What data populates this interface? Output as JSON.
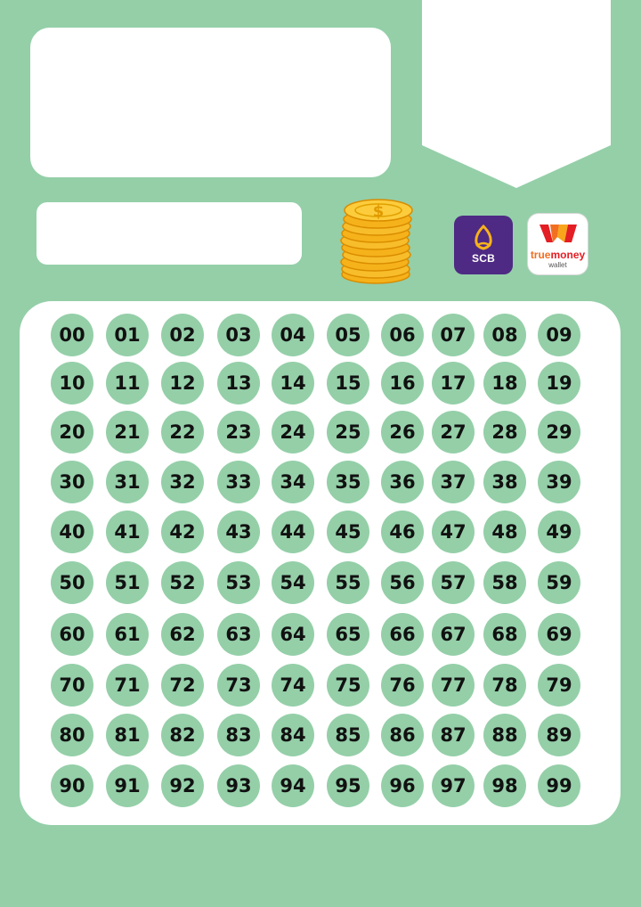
{
  "colors": {
    "background": "#94cfa8",
    "panel": "#ffffff",
    "circle": "#94cfa8",
    "scb_purple": "#4e2a84",
    "coin": "#f6b21a"
  },
  "logos": {
    "scb": {
      "text": "SCB",
      "icon": "scb-bank-logo"
    },
    "truemoney": {
      "true_text": "true",
      "money_text": "money",
      "sub_text": "wallet",
      "icon": "truemoney-wallet-logo"
    }
  },
  "decor": {
    "coins_icon": "coin-stack-icon",
    "dollar_sign": "$"
  },
  "numbers": [
    "00",
    "01",
    "02",
    "03",
    "04",
    "05",
    "06",
    "07",
    "08",
    "09",
    "10",
    "11",
    "12",
    "13",
    "14",
    "15",
    "16",
    "17",
    "18",
    "19",
    "20",
    "21",
    "22",
    "23",
    "24",
    "25",
    "26",
    "27",
    "28",
    "29",
    "30",
    "31",
    "32",
    "33",
    "34",
    "35",
    "36",
    "37",
    "38",
    "39",
    "40",
    "41",
    "42",
    "43",
    "44",
    "45",
    "46",
    "47",
    "48",
    "49",
    "50",
    "51",
    "52",
    "53",
    "54",
    "55",
    "56",
    "57",
    "58",
    "59",
    "60",
    "61",
    "62",
    "63",
    "64",
    "65",
    "66",
    "67",
    "68",
    "69",
    "70",
    "71",
    "72",
    "73",
    "74",
    "75",
    "76",
    "77",
    "78",
    "79",
    "80",
    "81",
    "82",
    "83",
    "84",
    "85",
    "86",
    "87",
    "88",
    "89",
    "90",
    "91",
    "92",
    "93",
    "94",
    "95",
    "96",
    "97",
    "98",
    "99"
  ]
}
